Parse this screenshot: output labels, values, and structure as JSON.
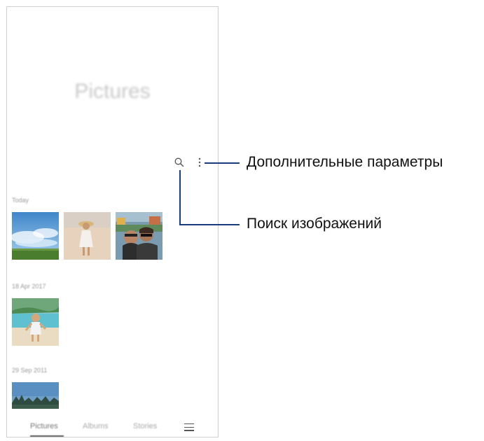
{
  "app": {
    "title": "Pictures"
  },
  "toolbar": {
    "search_icon": "search-icon",
    "more_icon": "more-vertical-icon"
  },
  "sections": [
    {
      "date": "Today"
    },
    {
      "date": "18 Apr 2017"
    },
    {
      "date": "29 Sep 2011"
    }
  ],
  "bottom_nav": {
    "tabs": [
      "Pictures",
      "Albums",
      "Stories"
    ],
    "active_tab": "Pictures",
    "menu_icon": "menu-icon"
  },
  "callouts": {
    "more_options": "Дополнительные параметры",
    "search_images": "Поиск изображений"
  },
  "colors": {
    "callout_line": "#1a3c7a"
  }
}
